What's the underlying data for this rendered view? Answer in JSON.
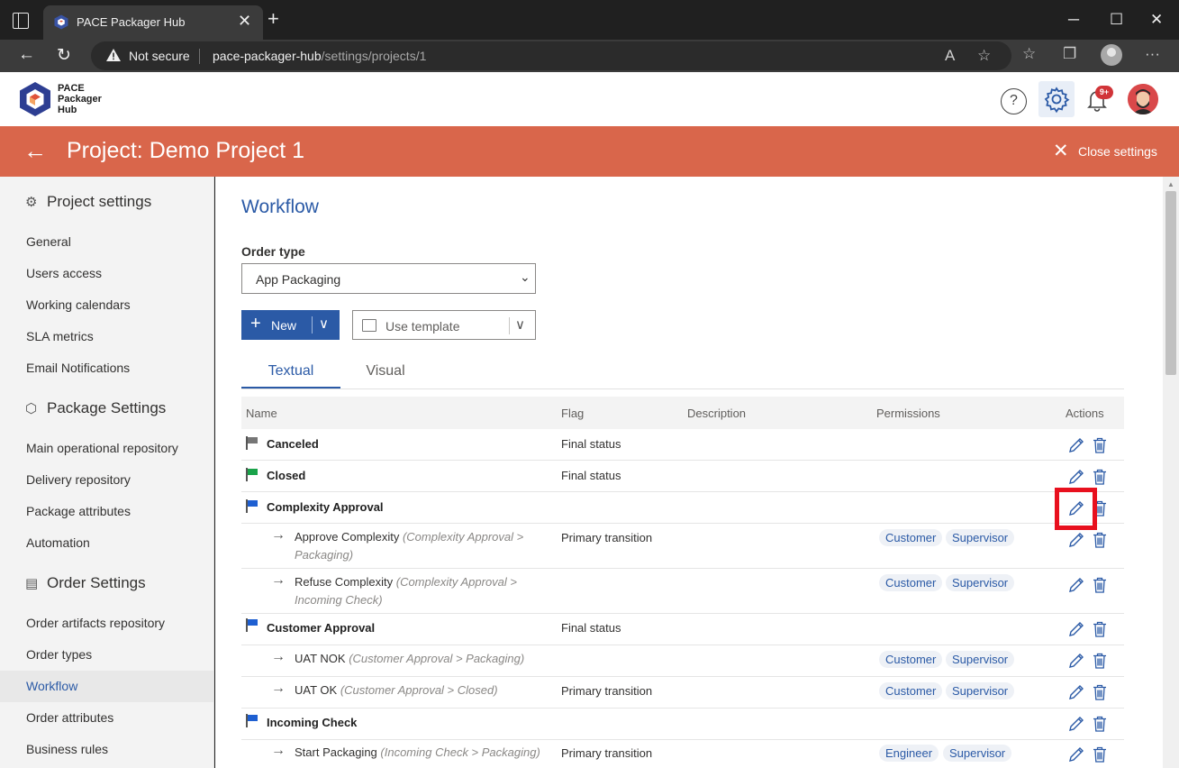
{
  "browser": {
    "tab_title": "PACE Packager Hub",
    "close_tab": "✕",
    "new_tab": "+",
    "security_label": "Not secure",
    "url_host": "pace-packager-hub",
    "url_path": "/settings/projects/1"
  },
  "app": {
    "logo_text_1": "PACE",
    "logo_text_2": "Packager",
    "logo_text_3": "Hub",
    "help_glyph": "?",
    "notification_badge": "9+"
  },
  "project_bar": {
    "title": "Project: Demo Project 1",
    "close_label": "Close settings"
  },
  "sidebar": {
    "project_settings": {
      "title": "Project settings",
      "items": [
        "General",
        "Users access",
        "Working calendars",
        "SLA metrics",
        "Email Notifications"
      ]
    },
    "package_settings": {
      "title": "Package Settings",
      "items": [
        "Main operational repository",
        "Delivery repository",
        "Package attributes",
        "Automation"
      ]
    },
    "order_settings": {
      "title": "Order Settings",
      "items": [
        "Order artifacts repository",
        "Order types",
        "Workflow",
        "Order attributes",
        "Business rules"
      ],
      "active": "Workflow"
    }
  },
  "main": {
    "title": "Workflow",
    "order_type_label": "Order type",
    "order_type_value": "App Packaging",
    "new_button": "New",
    "template_button": "Use template",
    "tabs": [
      "Textual",
      "Visual"
    ],
    "active_tab": "Textual",
    "columns": [
      "Name",
      "Flag",
      "Description",
      "Permissions",
      "Actions"
    ]
  },
  "workflow_rows": [
    {
      "kind": "status",
      "name": "Canceled",
      "flag": "Final status",
      "flag_color": "#767676"
    },
    {
      "kind": "status",
      "name": "Closed",
      "flag": "Final status",
      "flag_color": "#1aa34a"
    },
    {
      "kind": "status",
      "name": "Complexity Approval",
      "flag": "",
      "flag_color": "#1e5fd1"
    },
    {
      "kind": "transition",
      "name": "Approve Complexity",
      "path_1": "(Complexity Approval >",
      "path_2": "Packaging)",
      "flag": "Primary transition",
      "permissions": [
        "Customer",
        "Supervisor"
      ]
    },
    {
      "kind": "transition",
      "name": "Refuse Complexity",
      "path_1": "(Complexity Approval >",
      "path_2": "Incoming Check)",
      "flag": "",
      "permissions": [
        "Customer",
        "Supervisor"
      ]
    },
    {
      "kind": "status",
      "name": "Customer Approval",
      "flag": "Final status",
      "flag_color": "#1e5fd1"
    },
    {
      "kind": "transition",
      "name": "UAT NOK",
      "path_1": "(Customer Approval > Packaging)",
      "flag": "",
      "permissions": [
        "Customer",
        "Supervisor"
      ]
    },
    {
      "kind": "transition",
      "name": "UAT OK",
      "path_1": "(Customer Approval > Closed)",
      "flag": "Primary transition",
      "permissions": [
        "Customer",
        "Supervisor"
      ]
    },
    {
      "kind": "status",
      "name": "Incoming Check",
      "flag": "",
      "flag_color": "#1e5fd1"
    },
    {
      "kind": "transition",
      "name": "Start Packaging",
      "path_1": "(Incoming Check > Packaging)",
      "flag": "Primary transition",
      "permissions": [
        "Engineer",
        "Supervisor"
      ]
    }
  ],
  "colors": {
    "accent": "#2b5aa6",
    "project_bar": "#d9664b",
    "highlight": "#e8101e"
  },
  "icons": {
    "row_actions": [
      "pencil-icon",
      "trash-icon"
    ]
  }
}
